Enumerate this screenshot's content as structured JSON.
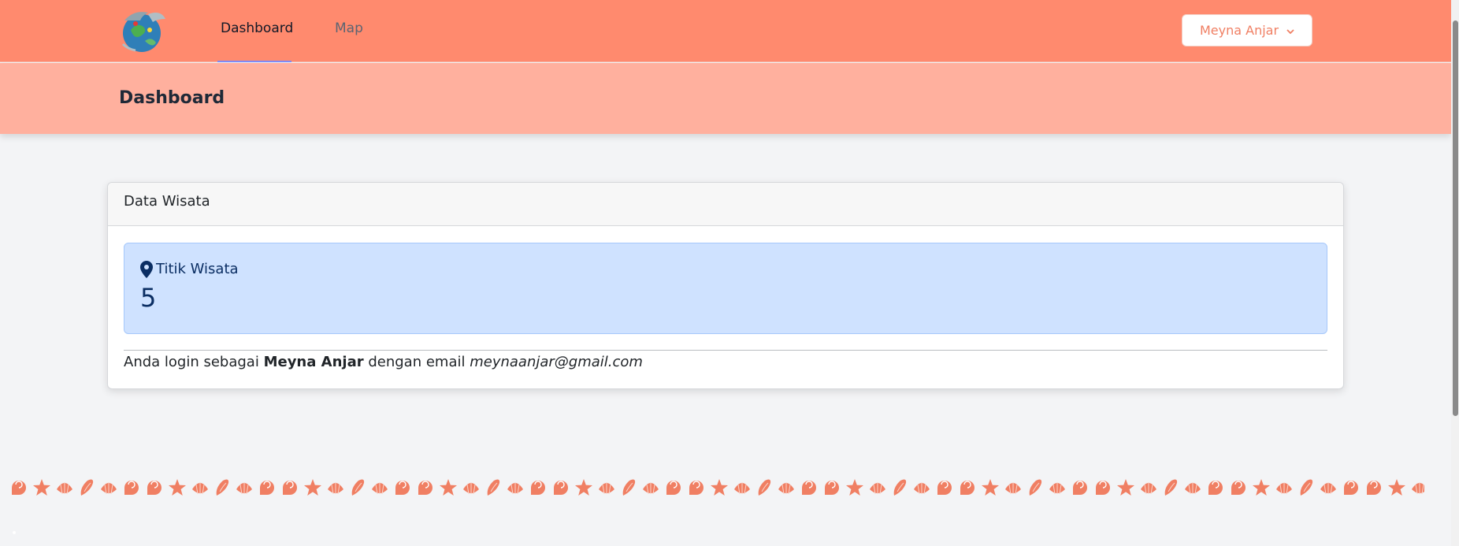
{
  "navbar": {
    "logo_icon": "globe-fish-logo",
    "links": [
      {
        "label": "Dashboard",
        "active": true
      },
      {
        "label": "Map",
        "active": false
      }
    ],
    "user_menu": {
      "label": "Meyna Anjar",
      "icon": "chevron-down-icon"
    }
  },
  "header": {
    "title": "Dashboard"
  },
  "card": {
    "title": "Data Wisata",
    "stat": {
      "icon": "map-pin-icon",
      "label": "Titik Wisata",
      "value": "5"
    },
    "login": {
      "prefix": "Anda login sebagai",
      "name": "Meyna Anjar",
      "middle": "dengan email",
      "email": "meynaanjar@gmail.com"
    }
  },
  "decoration": {
    "pattern_icons": [
      "shell-icon",
      "starfish-icon",
      "scallop-icon",
      "conch-icon"
    ]
  },
  "colors": {
    "navbar": "#ff8a6e",
    "header": "#ffb09e",
    "accent_underline": "#818cf8",
    "alert_bg": "#cfe2ff",
    "shell": "#f07f63"
  }
}
